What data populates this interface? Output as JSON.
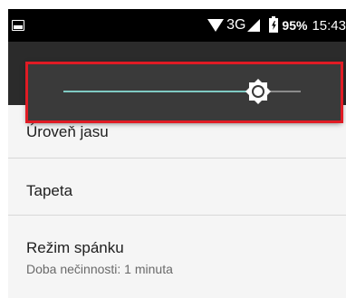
{
  "status_bar": {
    "network": "3G",
    "battery": "95%",
    "time": "15:43",
    "icons": [
      "image-icon",
      "wifi-icon",
      "signal-icon",
      "battery-icon"
    ]
  },
  "brightness": {
    "level": 0.82,
    "accent_color": "#80cbc4",
    "thumb_icon": "brightness-icon",
    "highlight_color": "#e01b24"
  },
  "settings": {
    "items": [
      {
        "title": "Úroveň jasu"
      },
      {
        "title": "Tapeta"
      },
      {
        "title": "Režim spánku",
        "subtitle": "Doba nečinnosti: 1 minuta"
      }
    ]
  }
}
